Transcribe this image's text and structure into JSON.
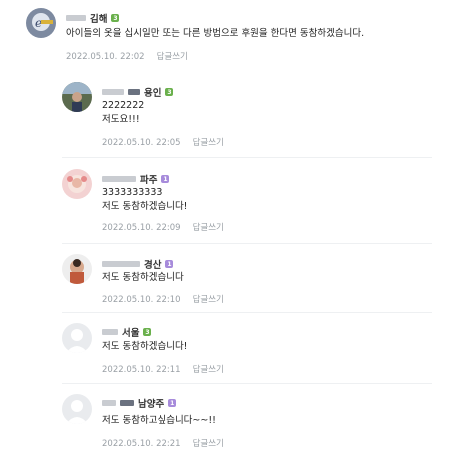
{
  "comments": [
    {
      "author": "김해",
      "badge_color": "green",
      "lines": [
        "아이들의 옷을 십시일만 또는 다른 방법으로 후원을 한다면 동참하겠습니다."
      ],
      "date": "2022.05.10. 22:02",
      "reply_label": "답글쓰기",
      "avatar_icon": "avatar-photo-icon"
    },
    {
      "author": "용인",
      "badge_color": "green",
      "lines": [
        "2222222",
        "저도요!!!"
      ],
      "date": "2022.05.10. 22:05",
      "reply_label": "답글쓰기",
      "avatar_icon": "avatar-photo-icon"
    },
    {
      "author": "파주",
      "badge_color": "purple",
      "lines": [
        "3333333333",
        "저도 동참하겠습니다!"
      ],
      "date": "2022.05.10. 22:09",
      "reply_label": "답글쓰기",
      "avatar_icon": "avatar-photo-icon"
    },
    {
      "author": "경산",
      "badge_color": "purple",
      "lines": [
        "저도 동참하겠습니다"
      ],
      "date": "2022.05.10. 22:10",
      "reply_label": "답글쓰기",
      "avatar_icon": "avatar-photo-icon"
    },
    {
      "author": "서울",
      "badge_color": "green",
      "lines": [
        "저도 동참하겠습니다!"
      ],
      "date": "2022.05.10. 22:11",
      "reply_label": "답글쓰기",
      "avatar_icon": "default-avatar-icon"
    },
    {
      "author": "남양주",
      "badge_color": "purple",
      "lines": [
        "저도 동참하고싶습니다~~!!"
      ],
      "date": "2022.05.10. 22:21",
      "reply_label": "답글쓰기",
      "avatar_icon": "default-avatar-icon"
    }
  ]
}
